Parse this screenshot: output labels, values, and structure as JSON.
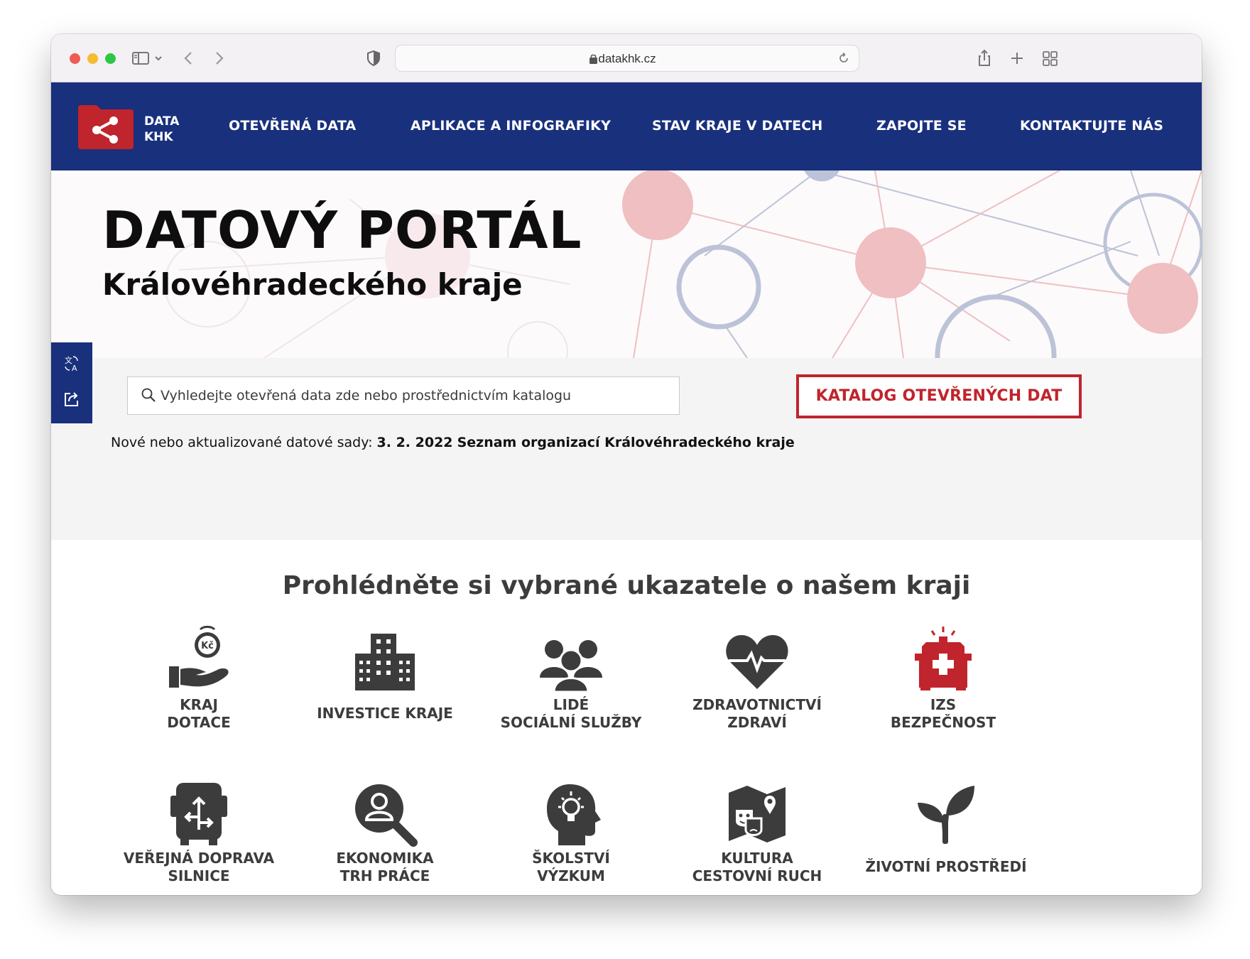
{
  "browser": {
    "url": "datakhk.cz"
  },
  "navbar": {
    "logo_line1": "DATA",
    "logo_line2": "KHK",
    "items": [
      {
        "label": "OTEVŘENÁ DATA"
      },
      {
        "label": "APLIKACE A INFOGRAFIKY"
      },
      {
        "label": "STAV KRAJE V DATECH"
      },
      {
        "label": "ZAPOJTE SE"
      },
      {
        "label": "KONTAKTUJTE NÁS"
      }
    ]
  },
  "hero": {
    "title": "DATOVÝ PORTÁL",
    "subtitle": "Královéhradeckého kraje"
  },
  "search": {
    "placeholder": "Vyhledejte otevřená data zde nebo prostřednictvím katalogu",
    "value": "",
    "catalog_button": "KATALOG OTEVŘENÝCH DAT"
  },
  "news": {
    "prefix": "Nové nebo aktualizované datové sady:",
    "date": "3. 2. 2022",
    "title": "Seznam organizací Královéhradeckého kraje"
  },
  "indicators": {
    "heading": "Prohlédněte si vybrané ukazatele o našem kraji",
    "tiles": [
      {
        "line1": "KRAJ",
        "line2": "DOTACE",
        "icon": "hand-coin-icon"
      },
      {
        "line1": "INVESTICE KRAJE",
        "line2": "",
        "icon": "buildings-icon"
      },
      {
        "line1": "LIDÉ",
        "line2": "SOCIÁLNÍ SLUŽBY",
        "icon": "people-group-icon"
      },
      {
        "line1": "ZDRAVOTNICTVÍ",
        "line2": "ZDRAVÍ",
        "icon": "heart-pulse-icon"
      },
      {
        "line1": "IZS",
        "line2": "BEZPEČNOST",
        "icon": "ambulance-icon"
      },
      {
        "line1": "VEŘEJNÁ DOPRAVA",
        "line2": "SILNICE",
        "icon": "bus-directions-icon"
      },
      {
        "line1": "EKONOMIKA",
        "line2": "TRH PRÁCE",
        "icon": "person-search-icon"
      },
      {
        "line1": "ŠKOLSTVÍ",
        "line2": "VÝZKUM",
        "icon": "head-lightbulb-icon"
      },
      {
        "line1": "KULTURA",
        "line2": "CESTOVNÍ RUCH",
        "icon": "map-masks-icon"
      },
      {
        "line1": "ŽIVOTNÍ PROSTŘEDÍ",
        "line2": "",
        "icon": "sprout-icon"
      }
    ]
  },
  "colors": {
    "nav_blue": "#19307c",
    "brand_red": "#c0242c",
    "icon_gray": "#3c3c3c"
  }
}
